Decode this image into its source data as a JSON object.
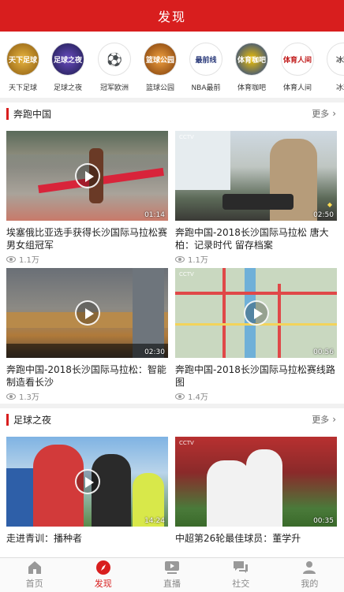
{
  "header": {
    "title": "发现"
  },
  "channels": [
    {
      "label": "天下足球",
      "badge": "天下足球",
      "color": "#c58a1e",
      "icon": "tianxia-zuqiu-logo"
    },
    {
      "label": "足球之夜",
      "badge": "足球之夜",
      "color": "#2c2e6e",
      "icon": "zuqiu-zhiye-logo"
    },
    {
      "label": "冠军欧洲",
      "badge": "⚽",
      "color": "#ffffff",
      "icon": "champions-league-logo"
    },
    {
      "label": "篮球公园",
      "badge": "篮球公园",
      "color": "#c86a1a",
      "icon": "lanqiu-gongyuan-logo"
    },
    {
      "label": "NBA最前",
      "badge": "最前线",
      "color": "#ffffff",
      "icon": "nba-zuiqian-logo"
    },
    {
      "label": "体育咖吧",
      "badge": "体育咖吧",
      "color": "#1c3f99",
      "icon": "tiyu-kaba-logo"
    },
    {
      "label": "体育人间",
      "badge": "体育人间",
      "color": "#ffffff",
      "icon": "tiyu-renjian-logo"
    },
    {
      "label": "冰球",
      "badge": "冰球",
      "color": "#ffffff",
      "icon": "bingqiu-logo"
    }
  ],
  "sections": [
    {
      "title": "奔跑中国",
      "more": "更多",
      "cards": [
        {
          "title": "埃塞俄比亚选手获得长沙国际马拉松赛男女组冠军",
          "views": "1.1万",
          "duration": "01:14"
        },
        {
          "title": "奔跑中国-2018长沙国际马拉松 唐大柏：记录时代 留存档案",
          "views": "1.1万",
          "duration": "02:50"
        },
        {
          "title": "奔跑中国-2018长沙国际马拉松：智能制造看长沙",
          "views": "1.3万",
          "duration": "02:30"
        },
        {
          "title": "奔跑中国-2018长沙国际马拉松赛线路图",
          "views": "1.4万",
          "duration": "00:56"
        }
      ]
    },
    {
      "title": "足球之夜",
      "more": "更多",
      "cards": [
        {
          "title": "走进青训：播种者",
          "duration": "14:24"
        },
        {
          "title": "中超第26轮最佳球员：董学升",
          "duration": "00:35"
        }
      ]
    }
  ],
  "tabbar": [
    {
      "label": "首页",
      "icon": "home-icon",
      "active": false
    },
    {
      "label": "发现",
      "icon": "compass-icon",
      "active": true
    },
    {
      "label": "直播",
      "icon": "live-play-icon",
      "active": false
    },
    {
      "label": "社交",
      "icon": "chat-bubbles-icon",
      "active": false
    },
    {
      "label": "我的",
      "icon": "user-icon",
      "active": false
    }
  ],
  "colors": {
    "brand_red": "#d81e1e",
    "divider": "#f1f1f1",
    "text_secondary": "#888888"
  }
}
